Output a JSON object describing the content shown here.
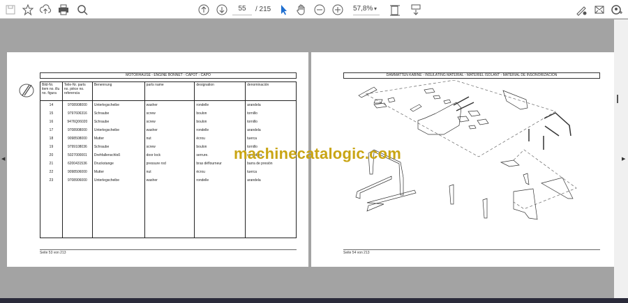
{
  "toolbar": {
    "page_current": "55",
    "page_total": "/ 215",
    "zoom": "57,8%"
  },
  "left_page": {
    "title": "MOTORHAUSE - ENGINE BONNET - CAPOT - CAPO",
    "columns": [
      "Bild-Nr. item no. illu no. figura",
      "Teile-Nr. parts no. pièce no. referencia",
      "Benennung",
      "parts name",
      "designation",
      "denominación"
    ],
    "rows": [
      [
        "14",
        "9708908000",
        "Unterlegscheibe",
        "washer",
        "rondelle",
        "arandela"
      ],
      [
        "15",
        "9797606316",
        "Schraube",
        "screw",
        "boulon",
        "tornillo"
      ],
      [
        "16",
        "9476Q06020",
        "Schraube",
        "screw",
        "boulon",
        "tornillo"
      ],
      [
        "17",
        "9708908000",
        "Unterlegscheibe",
        "washer",
        "rondelle",
        "arandela"
      ],
      [
        "18",
        "9098508000",
        "Mutter",
        "nut",
        "écrou",
        "tuerca"
      ],
      [
        "19",
        "9799108036",
        "Schraube",
        "screw",
        "boulon",
        "tornillo"
      ],
      [
        "20",
        "5027000001",
        "Drehfallenschloß",
        "door lock",
        "serrure.",
        "cerradura"
      ],
      [
        "21",
        "6200431536",
        "Druckstange",
        "pressure rod",
        "bras déflourneur",
        "barra de presión"
      ],
      [
        "22",
        "9098506000",
        "Mutter",
        "nut",
        "écrou",
        "tuerca"
      ],
      [
        "23",
        "9708906000",
        "Unterlegscheibe",
        "washer",
        "rondelle",
        "arandela"
      ]
    ],
    "footer": "Seite 53 von 213"
  },
  "right_page": {
    "title": "DÄMMATTEN KABINE - INSULATING MATERIAL - MATERIEL ISOLANT - MATERIAL DE INSONORIZACIÓN",
    "footer": "Seite 54 von 213"
  },
  "watermark": "machinecatalogic.com"
}
